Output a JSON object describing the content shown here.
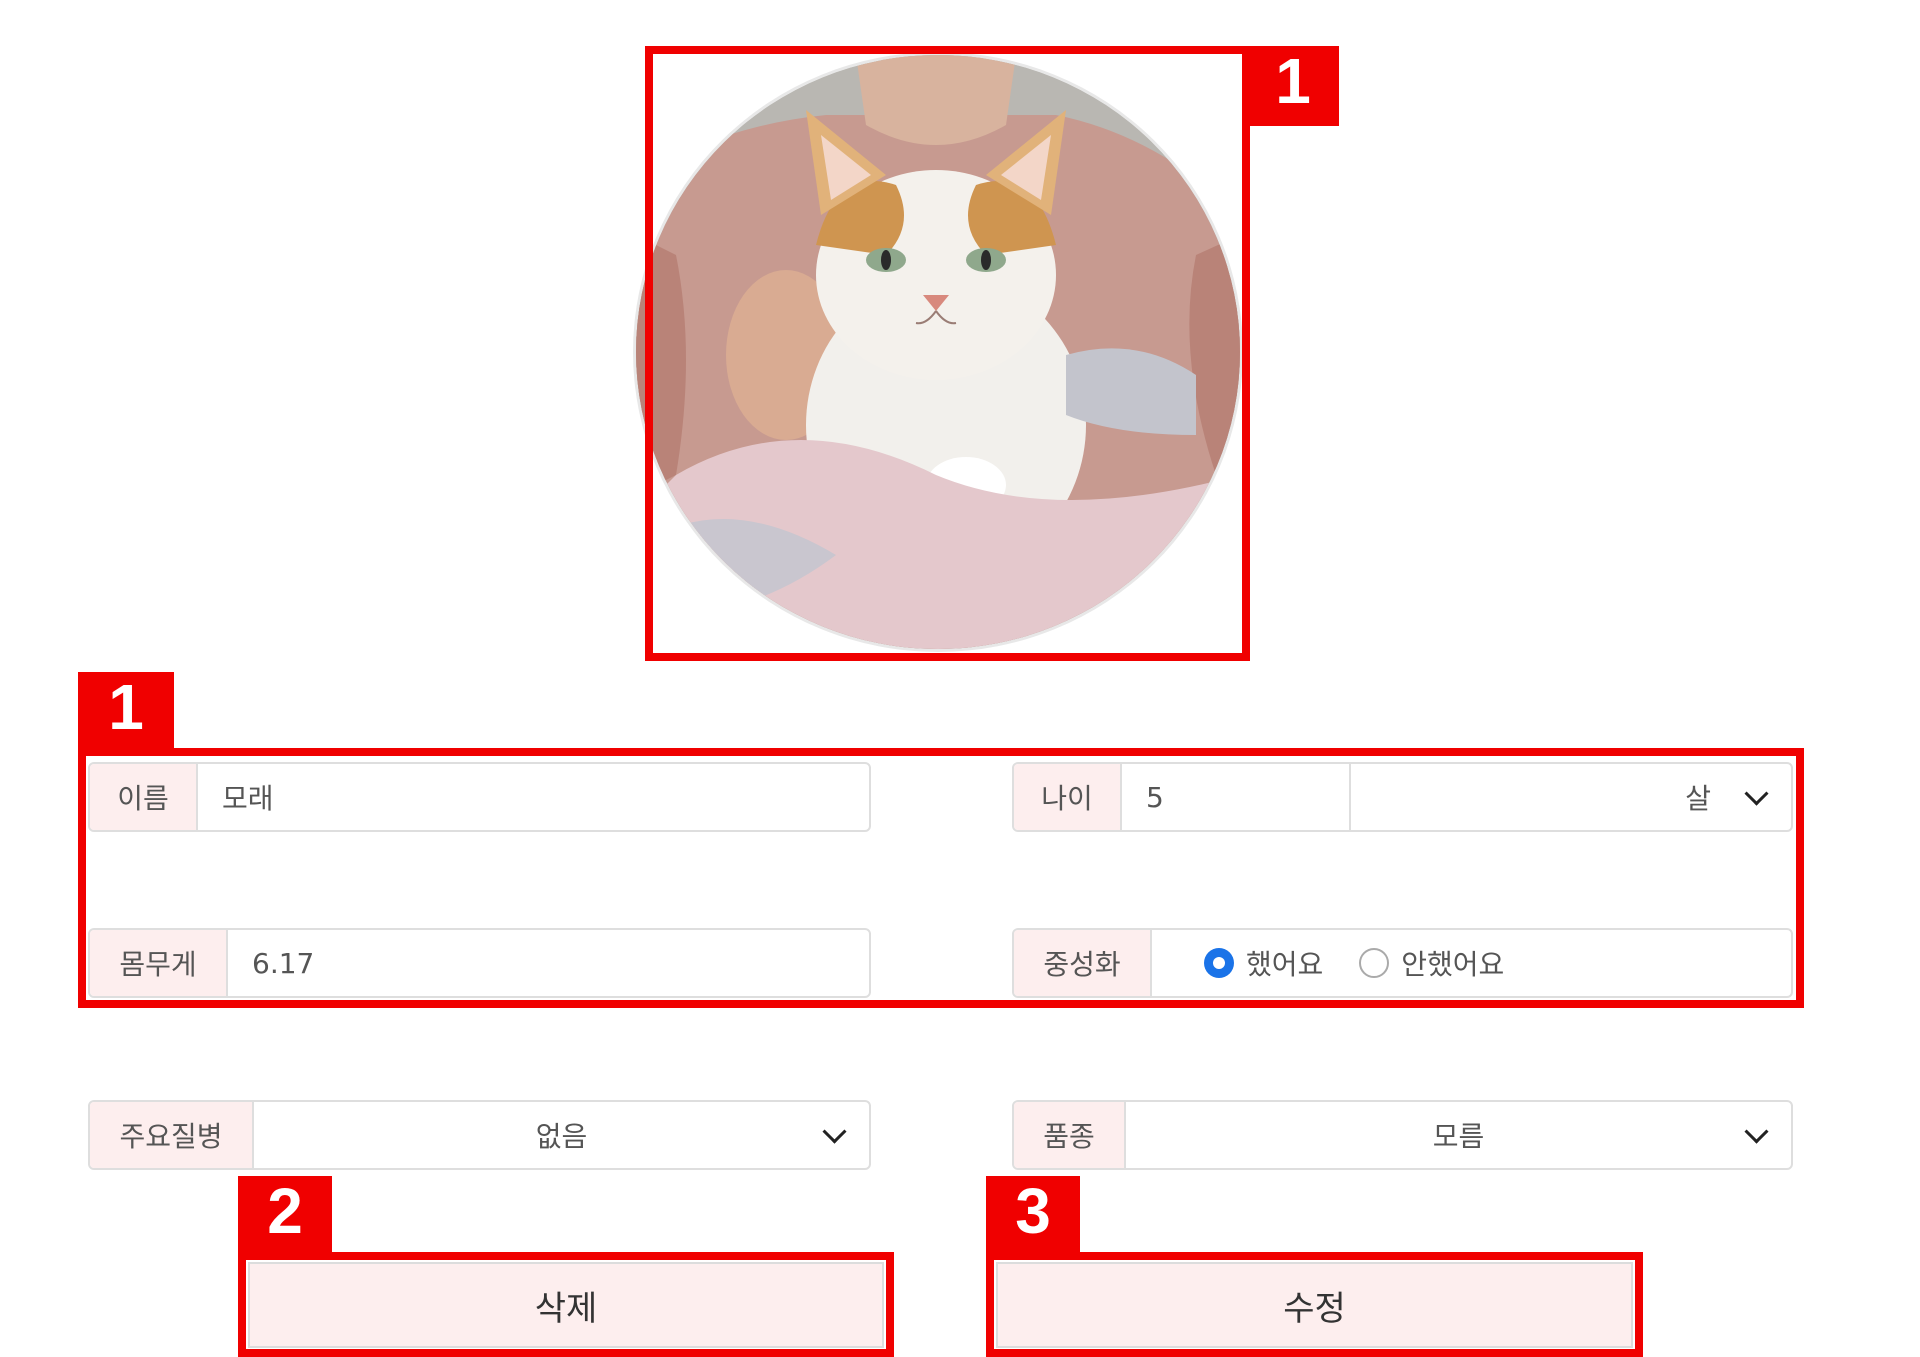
{
  "profile": {
    "photo_alt": "고양이 사진"
  },
  "form": {
    "name": {
      "label": "이름",
      "value": "모래"
    },
    "age": {
      "label": "나이",
      "value": "5",
      "unit": "살"
    },
    "weight": {
      "label": "몸무게",
      "value": "6.17"
    },
    "neuter": {
      "label": "중성화",
      "option_yes": "했어요",
      "option_no": "안했어요",
      "selected": "했어요"
    },
    "disease": {
      "label": "주요질병",
      "value": "없음"
    },
    "breed": {
      "label": "품종",
      "value": "모름"
    }
  },
  "buttons": {
    "delete": "삭제",
    "edit": "수정"
  },
  "annotations": {
    "tag_1a": "1",
    "tag_1b": "1",
    "tag_2": "2",
    "tag_3": "3",
    "color": "#f00000"
  },
  "colors": {
    "label_bg": "#fdeeee",
    "radio_checked": "#1a73e8",
    "border": "#dedede"
  }
}
